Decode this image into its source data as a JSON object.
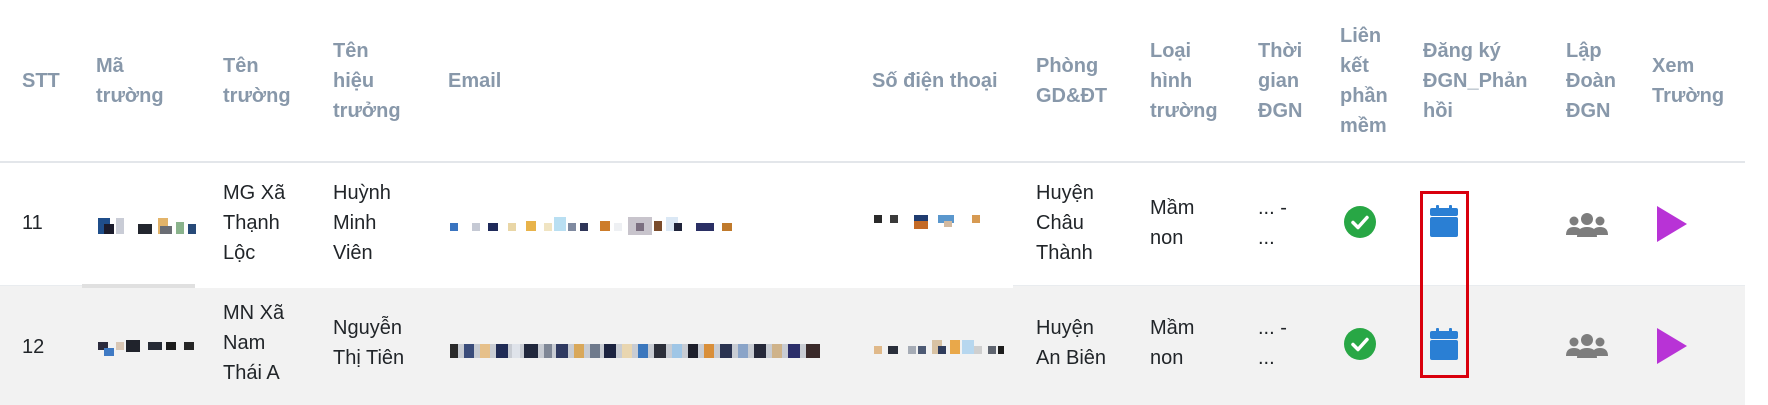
{
  "table": {
    "headers": {
      "stt": "STT",
      "ma_truong": "Mã trường",
      "ten_truong": "Tên trường",
      "ten_hieu_truong": "Tên hiệu trưởng",
      "email": "Email",
      "so_dien_thoai": "Số điện thoại",
      "phong_gddt": "Phòng GD&ĐT",
      "loai_hinh_truong": "Loại hình trường",
      "thoi_gian_dgn": "Thời gian ĐGN",
      "lien_ket_phan_mem": "Liên kết phần mềm",
      "dang_ky_dgn_phan_hoi": "Đăng ký ĐGN_Phản hồi",
      "lap_doan_dgn": "Lập Đoàn ĐGN",
      "xem_truong": "Xem Trường"
    },
    "header_lines": {
      "ma_truong": [
        "Mã",
        "trường"
      ],
      "ten_truong": [
        "Tên",
        "trường"
      ],
      "ten_hieu_truong": [
        "Tên",
        "hiệu",
        "trưởng"
      ],
      "phong_gddt": [
        "Phòng",
        "GD&ĐT"
      ],
      "loai_hinh_truong": [
        "Loại",
        "hình",
        "trường"
      ],
      "thoi_gian_dgn": [
        "Thời",
        "gian",
        "ĐGN"
      ],
      "lien_ket_phan_mem": [
        "Liên",
        "kết",
        "phần",
        "mềm"
      ],
      "dang_ky_dgn_phan_hoi": [
        "Đăng ký",
        "ĐGN_Phản",
        "hồi"
      ],
      "lap_doan_dgn": [
        "Lập",
        "Đoàn",
        "ĐGN"
      ],
      "xem_truong": [
        "Xem",
        "Trường"
      ]
    },
    "rows": [
      {
        "stt": "11",
        "ten_truong_lines": [
          "MG Xã",
          "Thạnh",
          "Lộc"
        ],
        "ten_hieu_truong_lines": [
          "Huỳnh",
          "Minh",
          "Viên"
        ],
        "phong_lines": [
          "Huyện",
          "Châu",
          "Thành"
        ],
        "loai_hinh_lines": [
          "Mầm",
          "non"
        ],
        "thoi_gian_lines": [
          "... -",
          "..."
        ]
      },
      {
        "stt": "12",
        "ten_truong_lines": [
          "MN Xã",
          "Nam",
          "Thái A"
        ],
        "ten_hieu_truong_lines": [
          "Nguyễn",
          "Thị Tiên"
        ],
        "phong_lines": [
          "Huyện",
          "An Biên"
        ],
        "loai_hinh_lines": [
          "Mầm",
          "non"
        ],
        "thoi_gian_lines": [
          "... -",
          "..."
        ]
      }
    ]
  },
  "icons": {
    "lien_ket": "check-circle-icon",
    "dang_ky": "calendar-icon",
    "lap_doan": "users-group-icon",
    "xem": "play-icon"
  },
  "colors": {
    "header_text": "#8898aa",
    "check_green": "#28a745",
    "calendar_blue": "#2a7fd4",
    "group_gray": "#808080",
    "play_purple": "#b833d6",
    "highlight_red": "#d9000d"
  }
}
